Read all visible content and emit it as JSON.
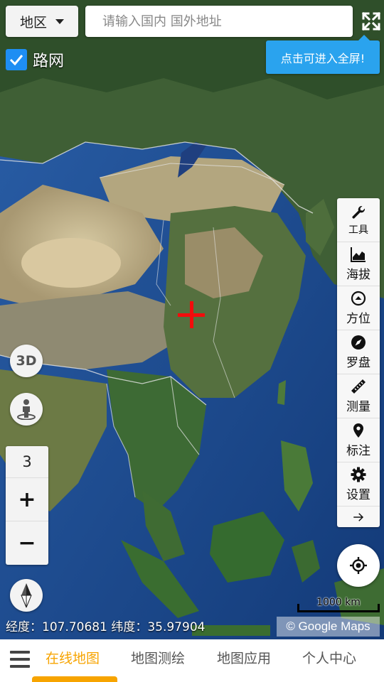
{
  "header": {
    "region_label": "地区",
    "search_placeholder": "请输入国内 国外地址",
    "fullscreen_tooltip": "点击可进入全屏!"
  },
  "roads": {
    "label": "路网",
    "checked": true
  },
  "toolbar": {
    "items": [
      {
        "label": "工具",
        "icon": "wrench-icon"
      },
      {
        "label": "海拔",
        "icon": "elevation-chart-icon"
      },
      {
        "label": "方位",
        "icon": "direction-icon"
      },
      {
        "label": "罗盘",
        "icon": "compass-icon"
      },
      {
        "label": "测量",
        "icon": "ruler-icon"
      },
      {
        "label": "标注",
        "icon": "map-pin-icon"
      },
      {
        "label": "设置",
        "icon": "gear-icon"
      },
      {
        "label": "",
        "icon": "arrow-right-icon"
      }
    ]
  },
  "left_controls": {
    "btn_3d": "3D",
    "zoom_level": "3",
    "zoom_in": "+",
    "zoom_out": "−"
  },
  "status": {
    "coords": "经度：107.70681 纬度：35.97904",
    "scale": "1000 km",
    "attribution": "© Google Maps"
  },
  "nav": {
    "tabs": [
      {
        "label": "在线地图",
        "active": true
      },
      {
        "label": "地图测绘",
        "active": false
      },
      {
        "label": "地图应用",
        "active": false
      },
      {
        "label": "个人中心",
        "active": false
      }
    ]
  },
  "colors": {
    "accent": "#f7a400",
    "tooltip": "#2aa3ee",
    "checkbox": "#1e8ef3",
    "crosshair": "#f30c0c"
  }
}
